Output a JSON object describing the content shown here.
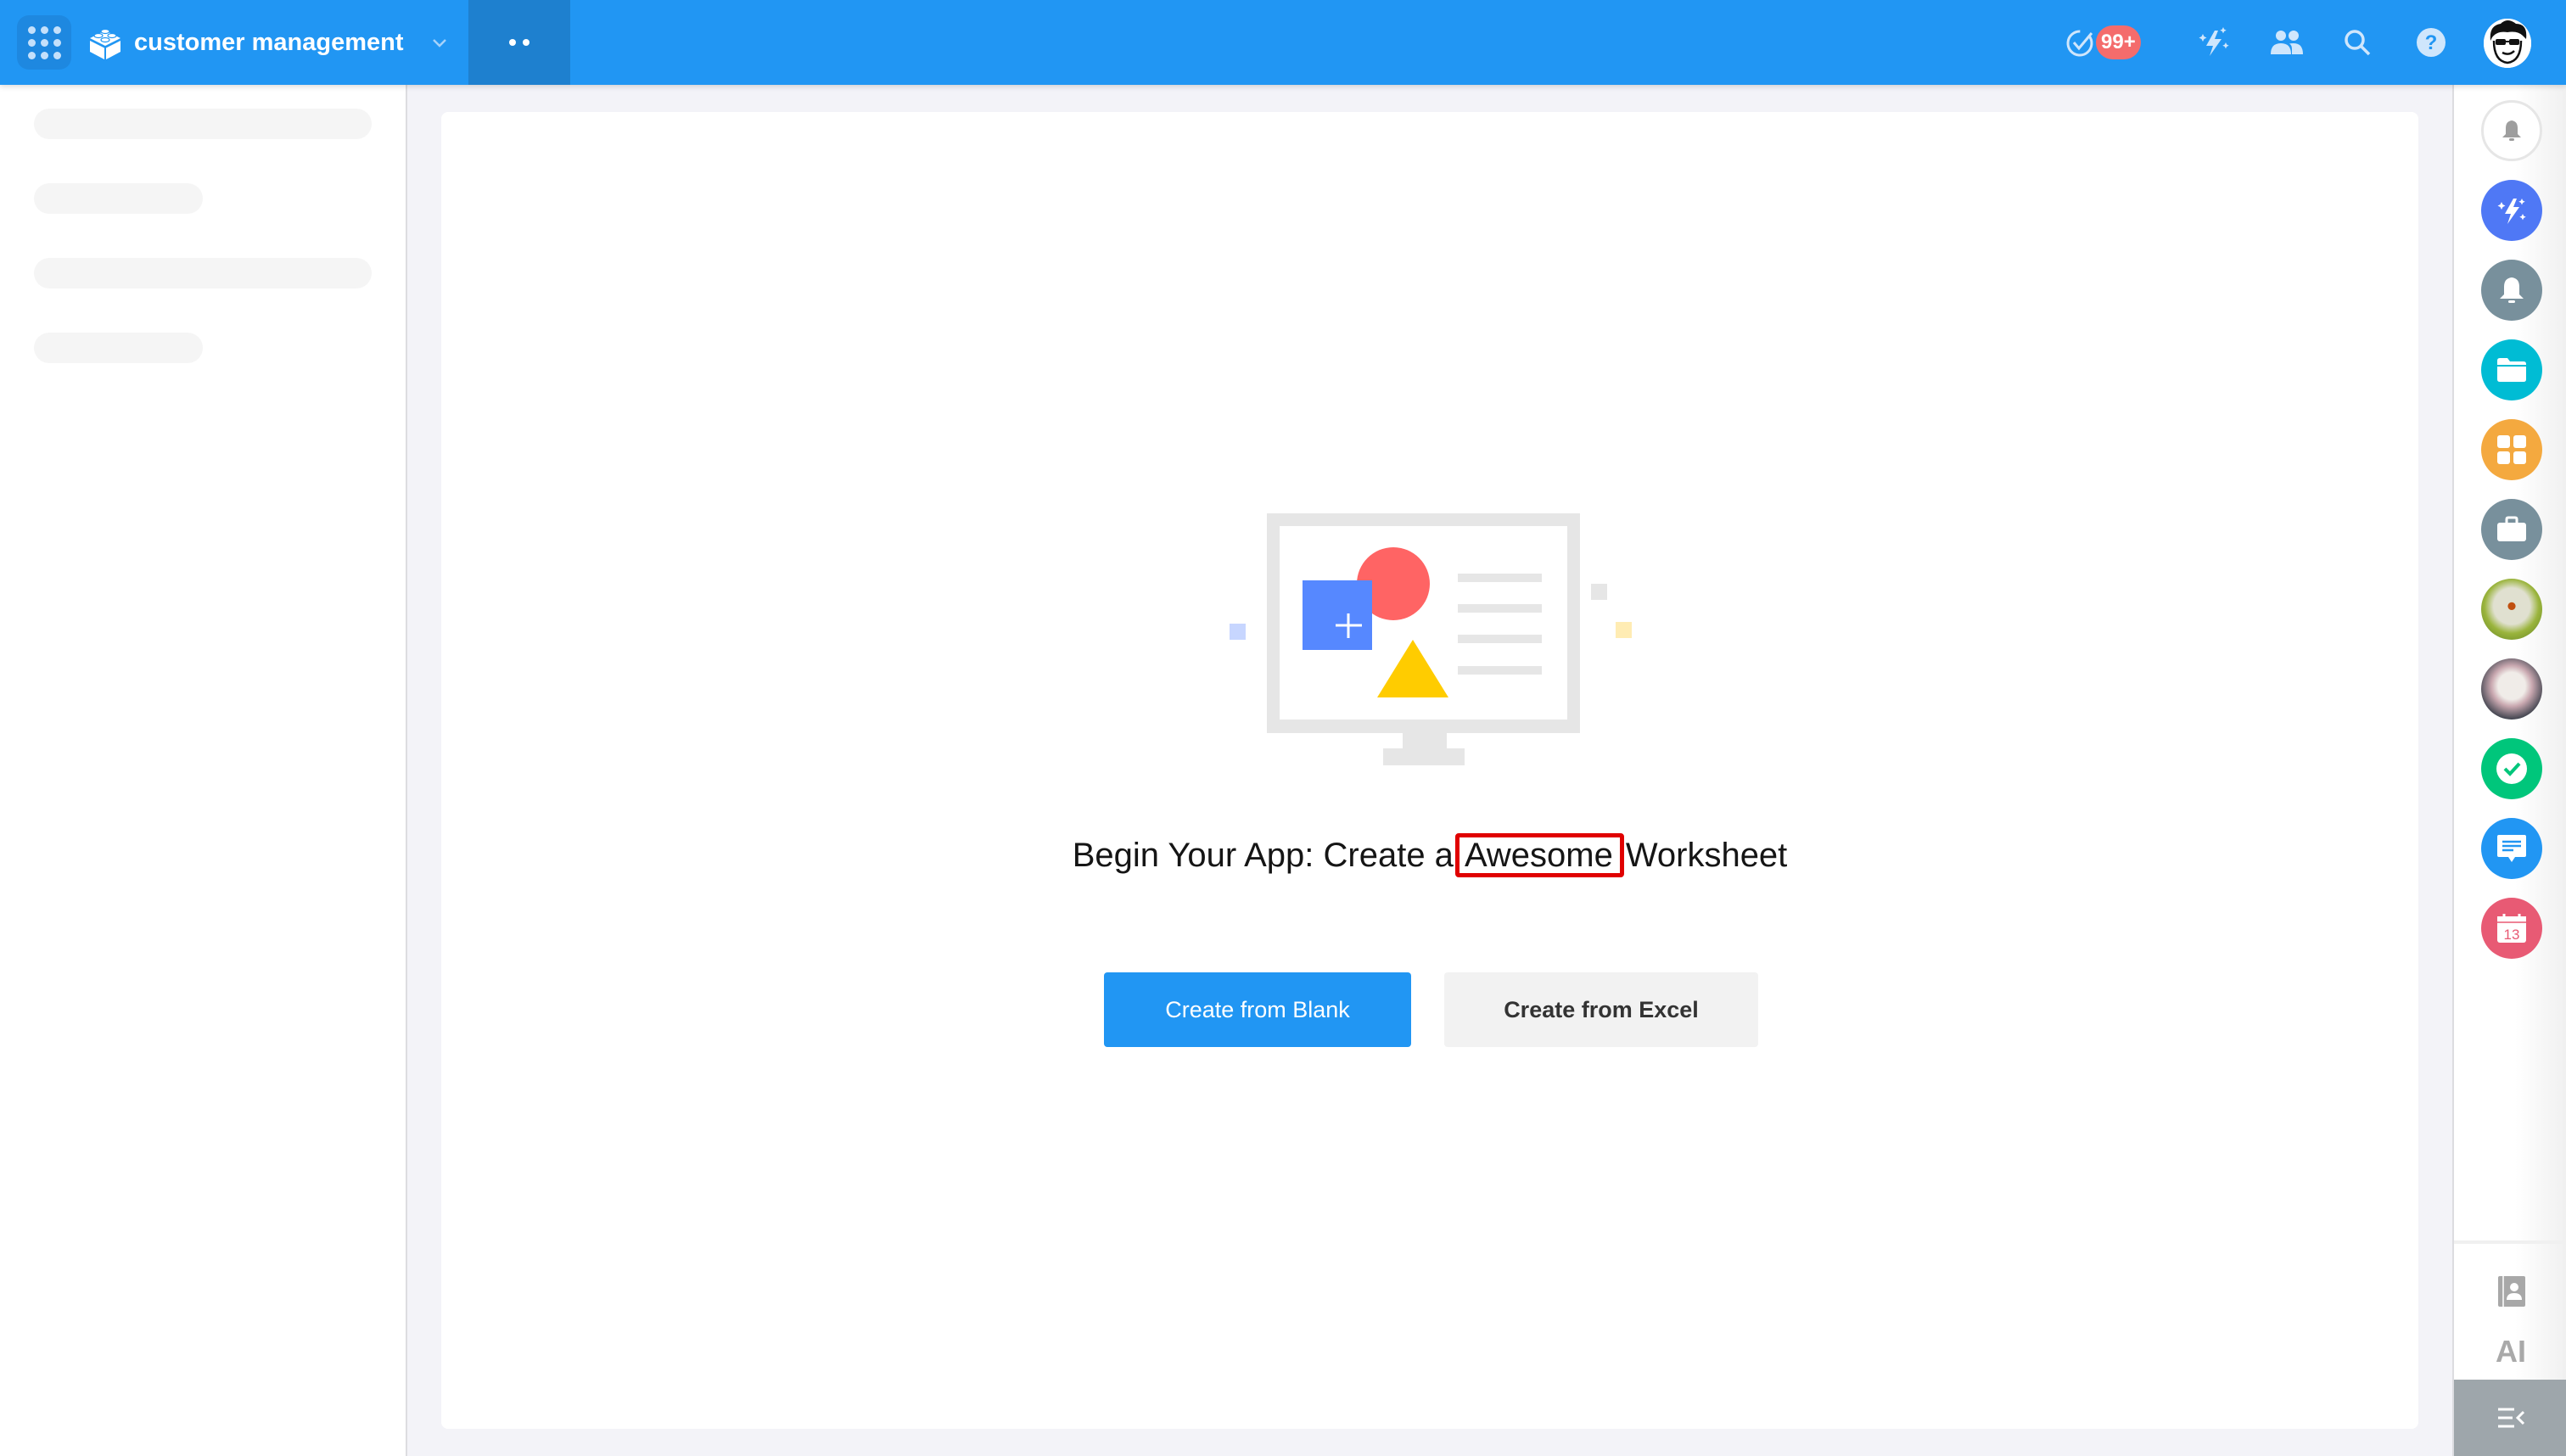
{
  "header": {
    "app_title": "customer management",
    "badge_count": "99+",
    "icons": [
      "apps-grid-icon",
      "app-logo-icon",
      "chevron-down-icon",
      "more-dots-icon",
      "task-check-icon",
      "sparkle-bolt-icon",
      "users-icon",
      "search-icon",
      "help-icon",
      "user-avatar"
    ]
  },
  "main": {
    "headline_prefix": "Begin Your App: Create a",
    "headline_highlight": "Awesome",
    "headline_suffix": "Worksheet",
    "buttons": {
      "create_blank": "Create from Blank",
      "create_excel": "Create from Excel"
    }
  },
  "right_sidebar": {
    "items": [
      {
        "name": "notification-bell",
        "color": "#ffffff"
      },
      {
        "name": "ai-assistant",
        "color": "#4f78f5"
      },
      {
        "name": "reminders",
        "color": "#78909c"
      },
      {
        "name": "files",
        "color": "#00bcd4"
      },
      {
        "name": "apps",
        "color": "#f4a93f"
      },
      {
        "name": "work",
        "color": "#78909c"
      },
      {
        "name": "dandelion-avatar",
        "color": "#8aa43a"
      },
      {
        "name": "tiger-avatar",
        "color": "#3a3f4a"
      },
      {
        "name": "tasks",
        "color": "#00c67b"
      },
      {
        "name": "messages",
        "color": "#2196f3"
      },
      {
        "name": "calendar",
        "color": "#e85a74"
      }
    ],
    "calendar_day": "13",
    "ai_label": "AI"
  },
  "colors": {
    "brand": "#2196f3",
    "badge": "#f46c6c",
    "highlight_border": "#e00000"
  }
}
